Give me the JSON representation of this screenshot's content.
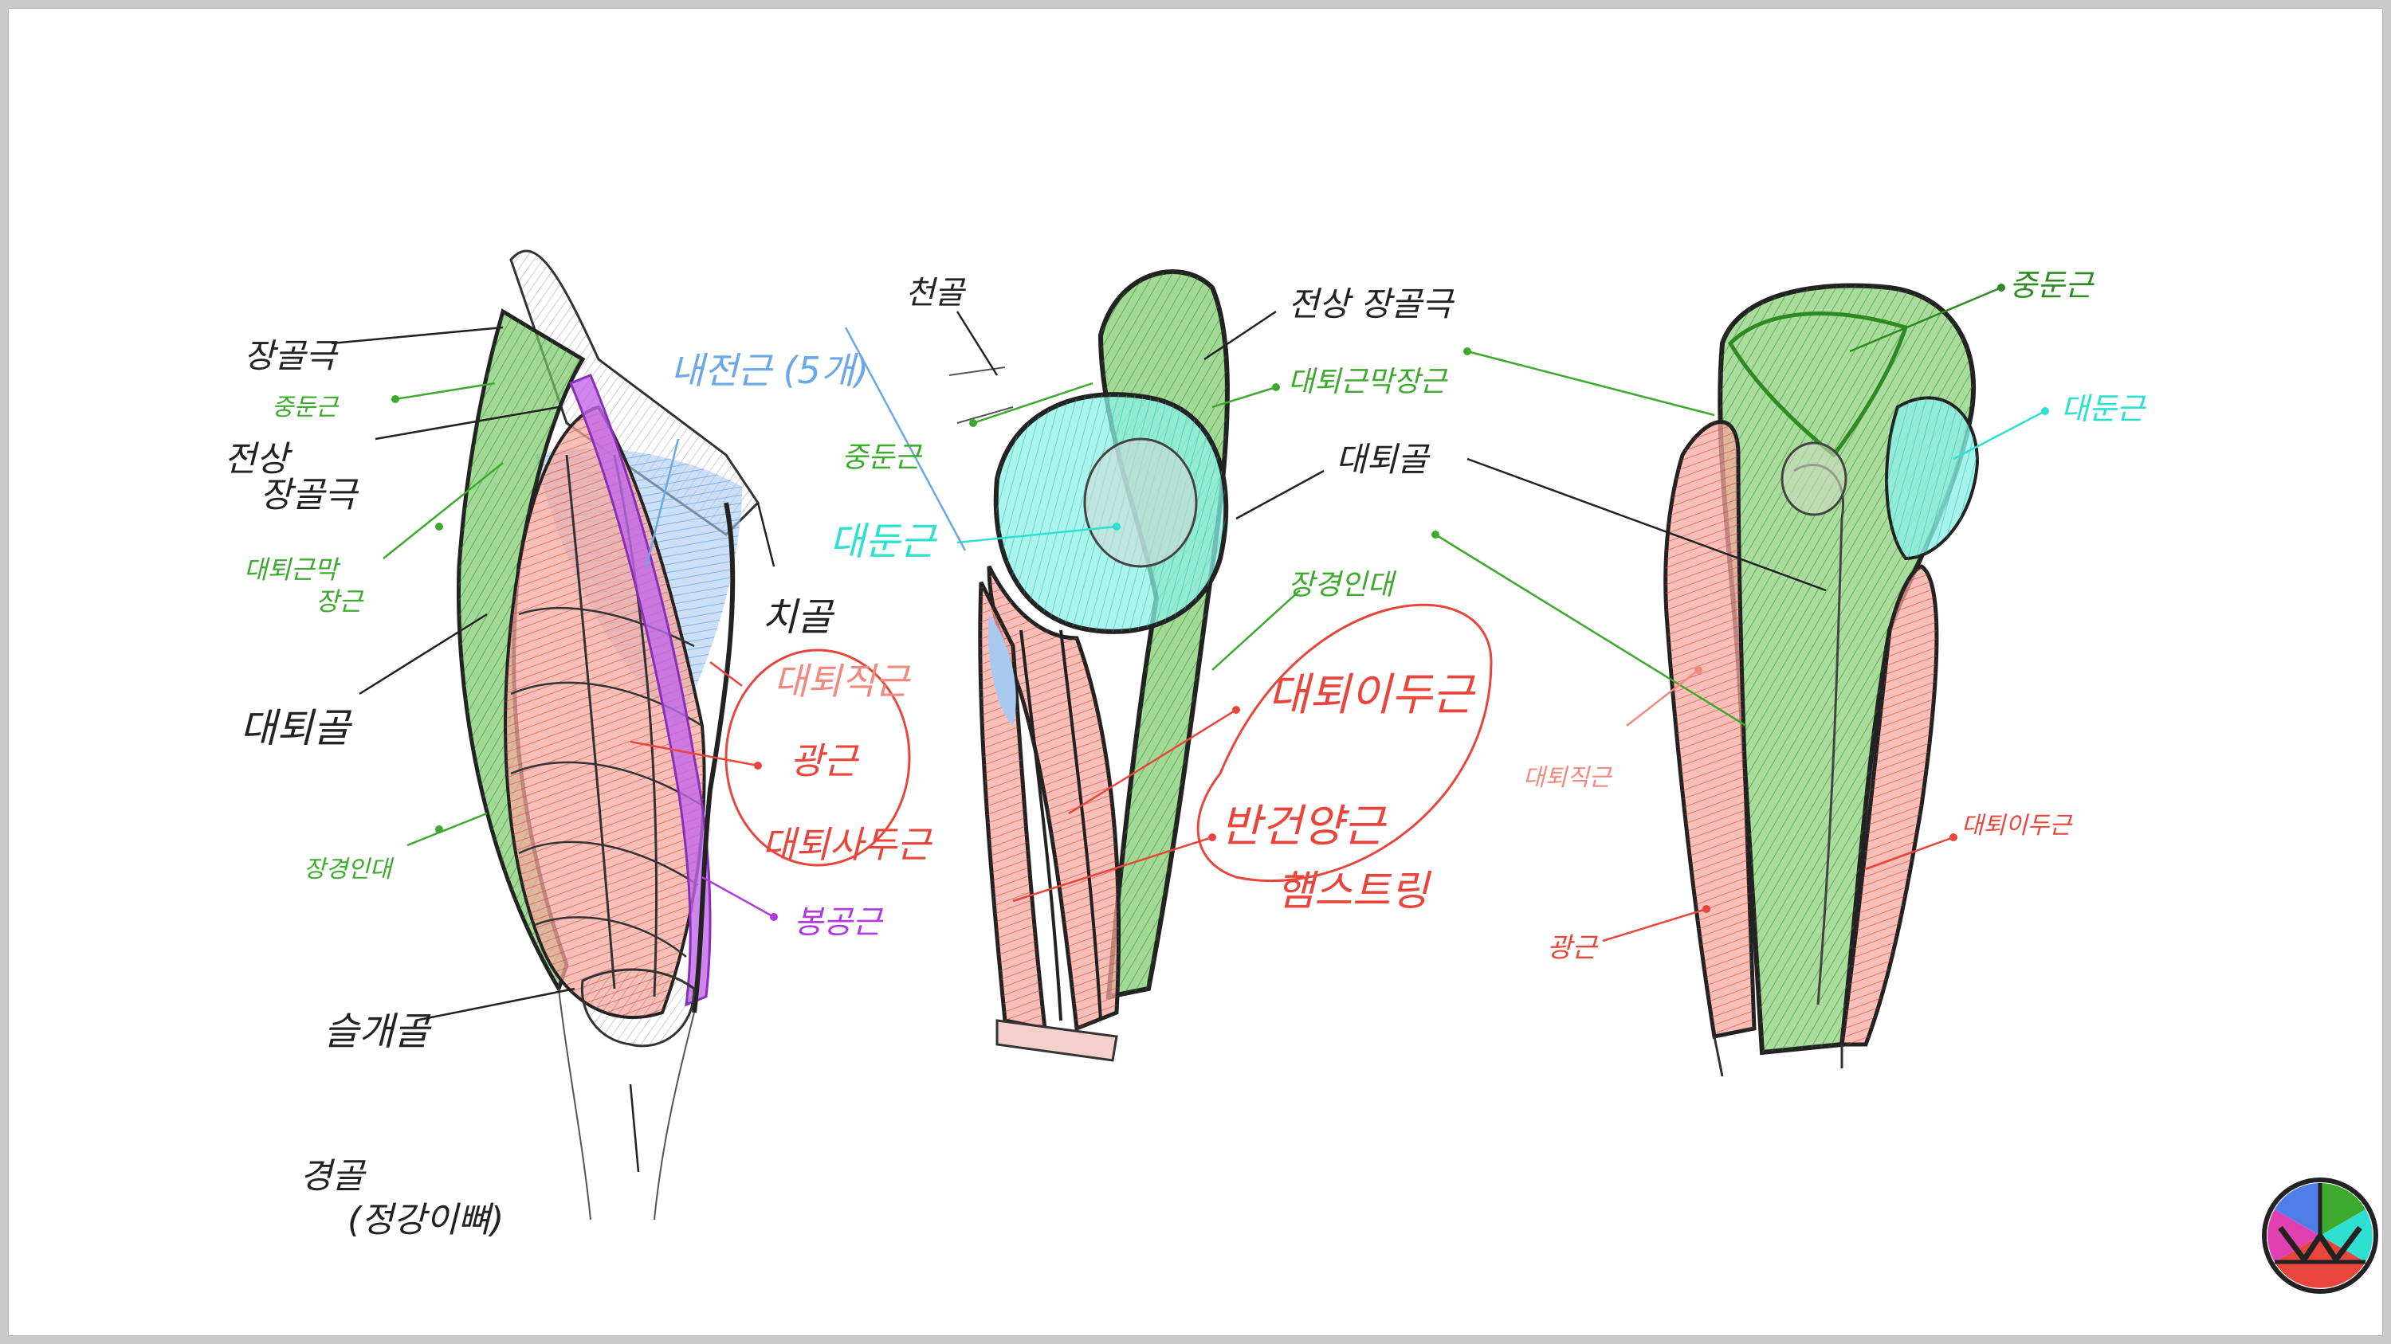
{
  "colors": {
    "black": "#222222",
    "green": "#3caa2c",
    "red": "#e8463c",
    "blue": "#6aa8e8",
    "cyan": "#2ee0d0",
    "purple": "#b03ae0",
    "pink": "#f08a80",
    "ink_green": "#2e8a22"
  },
  "front_view": {
    "labels": {
      "iliac_crest": "장골극",
      "gluteus_medius": "중둔근",
      "asis_line1": "전상",
      "asis_line2": "장골극",
      "tfl_line1": "대퇴근막",
      "tfl_line2": "장근",
      "femur": "대퇴골",
      "it_band": "장경인대",
      "patella": "슬개골",
      "tibia_line1": "경골",
      "tibia_line2": "(정강이뼈)",
      "adductors": "내전근 (5개)",
      "pubis": "치골",
      "rectus_femoris": "대퇴직근",
      "vastus": "광근",
      "quadriceps": "대퇴사두근",
      "sartorius": "봉공근"
    }
  },
  "side_view": {
    "labels": {
      "sacrum": "천골",
      "asis": "전상 장골극",
      "tfl": "대퇴근막장근",
      "femur": "대퇴골",
      "gluteus_medius": "중둔근",
      "gluteus_maximus": "대둔근",
      "it_band": "장경인대",
      "biceps_femoris": "대퇴이두근",
      "semimembranosus": "반건양근",
      "hamstring": "햄스트링"
    }
  },
  "back_view": {
    "labels": {
      "gluteus_medius": "중둔근",
      "gluteus_maximus": "대둔근",
      "rectus_femoris": "대퇴직근",
      "biceps_femoris": "대퇴이두근",
      "vastus": "광근"
    }
  }
}
